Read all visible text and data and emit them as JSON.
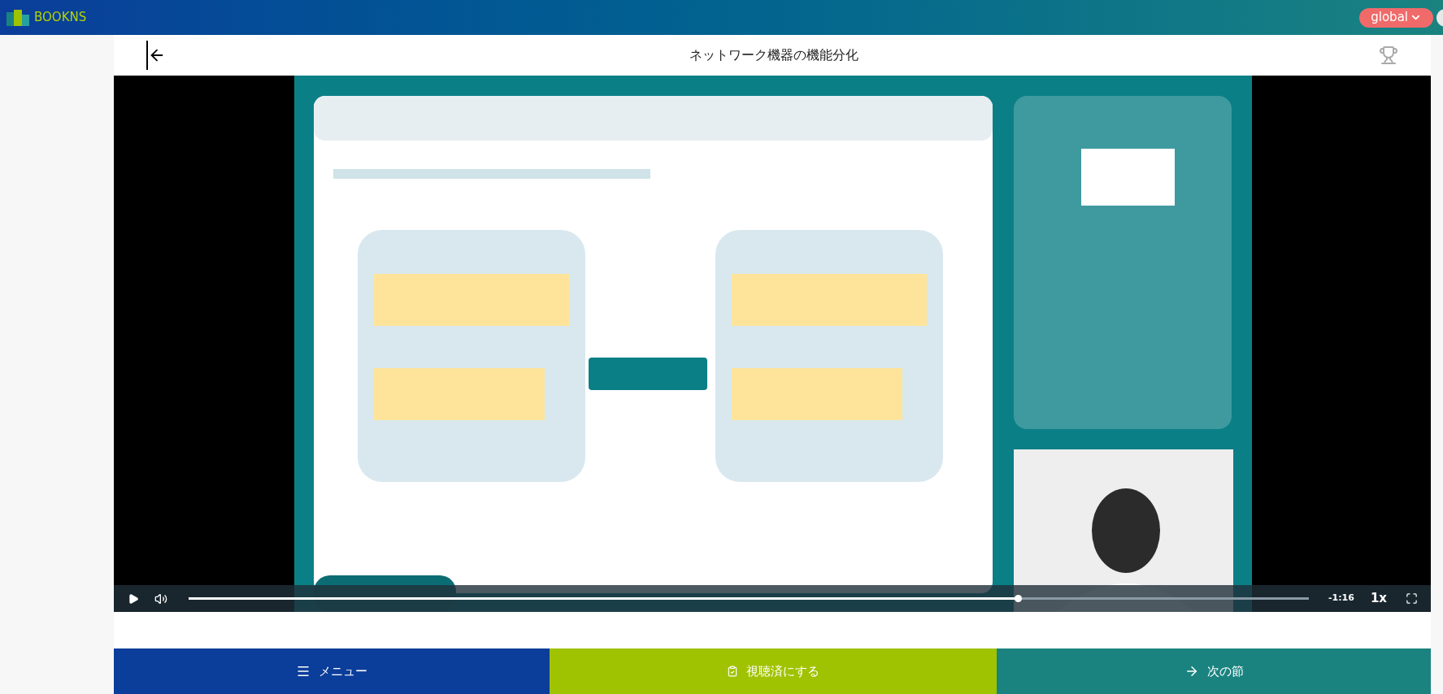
{
  "app_bar": {
    "logo_text": "BOOKNS",
    "workspace": "global"
  },
  "lesson": {
    "title": "ネットワーク機器の機能分化"
  },
  "video": {
    "kind": "picture",
    "progress": {
      "level": 0.74
    },
    "remaining": "-1:16",
    "speed": "1x"
  },
  "actions": [
    {
      "kind": "menu",
      "label": "メニュー"
    },
    {
      "kind": "watched",
      "label": "視聴済にする"
    },
    {
      "kind": "next",
      "label": "次の節"
    }
  ]
}
